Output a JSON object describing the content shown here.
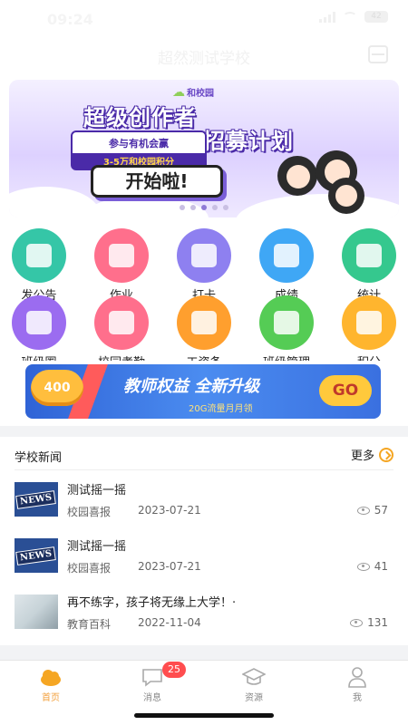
{
  "status": {
    "time": "09:24",
    "battery": "42"
  },
  "header": {
    "title": "超然测试学校"
  },
  "banner": {
    "logo": "和校园",
    "title_a": "超级创作者",
    "title_b": "招募计划",
    "pill_line1": "参与有机会赢",
    "pill_line2": "3-5万和校园积分",
    "button": "开始啦!"
  },
  "grid": [
    {
      "label": "发公告",
      "color": "#35c6a7",
      "icon": "megaphone-icon"
    },
    {
      "label": "作业",
      "color": "#ff6f8c",
      "icon": "homework-icon"
    },
    {
      "label": "打卡",
      "color": "#8e80f0",
      "icon": "calendar-icon"
    },
    {
      "label": "成绩",
      "color": "#3fa7f5",
      "icon": "check-badge-icon"
    },
    {
      "label": "统计",
      "color": "#35c88e",
      "icon": "trophy-icon"
    },
    {
      "label": "班级圈",
      "color": "#9b6cf0",
      "icon": "pinwheel-icon"
    },
    {
      "label": "校园考勤",
      "color": "#ff6f8c",
      "icon": "location-clock-icon"
    },
    {
      "label": "工资条",
      "color": "#ff9f2e",
      "icon": "payslip-icon"
    },
    {
      "label": "班级管理",
      "color": "#55cc55",
      "icon": "heart-plus-icon"
    },
    {
      "label": "积分",
      "color": "#ffb52e",
      "icon": "gift-icon"
    }
  ],
  "promo": {
    "coin": "400",
    "title": "教师权益 全新升级",
    "sub": "20G流量月月领",
    "go": "GO"
  },
  "news": {
    "title": "学校新闻",
    "more": "更多",
    "items": [
      {
        "title": "测试摇一摇",
        "source": "校园喜报",
        "date": "2023-07-21",
        "views": "57",
        "thumb": "NEWS"
      },
      {
        "title": "测试摇一摇",
        "source": "校园喜报",
        "date": "2023-07-21",
        "views": "41",
        "thumb": "NEWS"
      },
      {
        "title": "再不练字，孩子将无缘上大学！·",
        "source": "教育百科",
        "date": "2022-11-04",
        "views": "131",
        "thumb": ""
      }
    ]
  },
  "tabs": [
    {
      "label": "首页",
      "icon": "home-cloud-icon",
      "active": true
    },
    {
      "label": "消息",
      "icon": "message-icon",
      "badge": "25"
    },
    {
      "label": "资源",
      "icon": "graduation-cap-icon"
    },
    {
      "label": "我",
      "icon": "person-icon"
    }
  ]
}
